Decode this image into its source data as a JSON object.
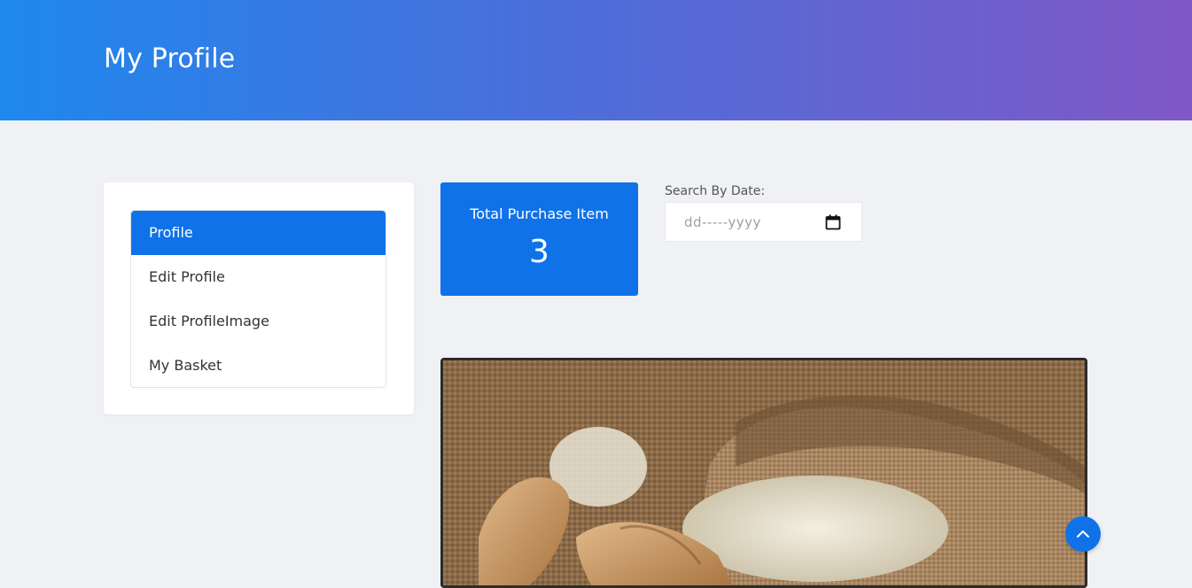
{
  "header": {
    "title": "My Profile",
    "gradient_start": "#1e88ee",
    "gradient_end": "#7f58c6"
  },
  "sidebar": {
    "items": [
      {
        "label": "Profile",
        "active": true
      },
      {
        "label": "Edit Profile",
        "active": false
      },
      {
        "label": "Edit ProfileImage",
        "active": false
      },
      {
        "label": "My Basket",
        "active": false
      }
    ]
  },
  "stats": {
    "label": "Total Purchase Item",
    "value": "3"
  },
  "search": {
    "label": "Search By Date:",
    "placeholder": "dd-----yyyy"
  },
  "product_image": {
    "alt": "rice"
  },
  "icons": {
    "calendar": "calendar-icon",
    "scroll_top": "chevron-up-icon"
  },
  "colors": {
    "accent": "#0f72e8",
    "background": "#eff1f5"
  }
}
